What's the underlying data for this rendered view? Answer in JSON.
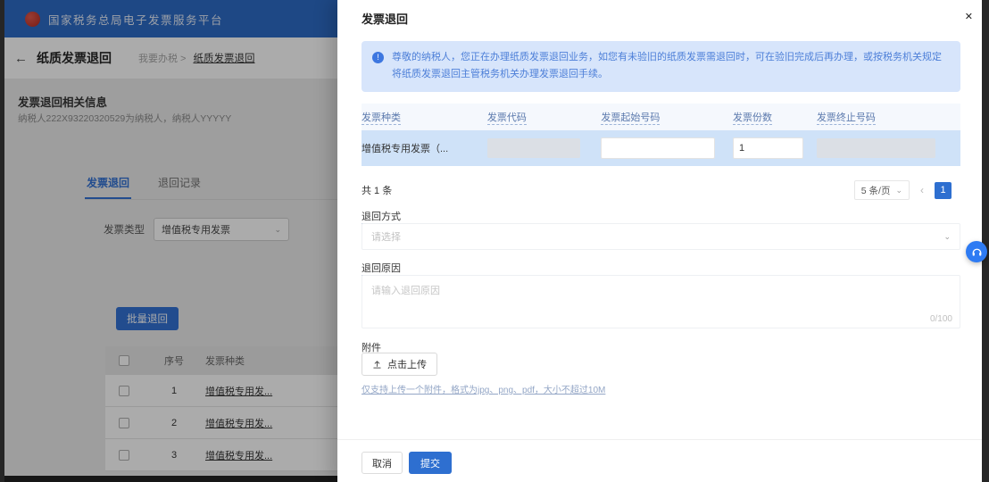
{
  "icons": {
    "back": "←",
    "close": "✕",
    "caret_down": "⌄",
    "page_prev": "‹",
    "alert_info": "!"
  },
  "header": {
    "title": "国家税务总局电子发票服务平台"
  },
  "left_page": {
    "page_title": "纸质发票退回",
    "breadcrumb_dim": "我要办税 >",
    "breadcrumb_current": "纸质发票退回",
    "info_title": "发票退回相关信息",
    "info_text": "纳税人222X93220320529为纳税人，纳税人YYYYY",
    "tabs": [
      {
        "label": "发票退回"
      },
      {
        "label": "退回记录"
      }
    ],
    "filter_label": "发票类型",
    "filter_value": "增值税专用发票",
    "batch_button": "批量退回",
    "table": {
      "col_seq": "序号",
      "col_type": "发票种类",
      "rows": [
        {
          "seq": "1",
          "type": "增值税专用发..."
        },
        {
          "seq": "2",
          "type": "增值税专用发..."
        },
        {
          "seq": "3",
          "type": "增值税专用发..."
        }
      ]
    }
  },
  "drawer": {
    "title": "发票退回",
    "alert_text": "尊敬的纳税人，您正在办理纸质发票退回业务，如您有未验旧的纸质发票需退回时，可在验旧完成后再办理，或按税务机关规定将纸质发票退回主管税务机关办理发票退回手续。",
    "table": {
      "headers": [
        "发票种类",
        "发票代码",
        "发票起始号码",
        "发票份数",
        "发票终止号码"
      ],
      "row": {
        "type": "增值税专用发票（...",
        "count": "1"
      }
    },
    "total_text": "共 1 条",
    "page_size": "5 条/页",
    "page_current": "1",
    "method_label": "退回方式",
    "method_placeholder": "请选择",
    "reason_label": "退回原因",
    "reason_placeholder": "请输入退回原因",
    "reason_counter": "0/100",
    "attachment_label": "附件",
    "upload_button": "点击上传",
    "upload_hint": "仅支持上传一个附件，格式为jpg、png、pdf，大小不超过10M",
    "cancel_button": "取消",
    "submit_button": "提交"
  },
  "colors": {
    "primary": "#2e6fd0",
    "header_blue": "#2a69c6",
    "alert_bg": "#d7e5fb",
    "alert_text": "#4d7fd8",
    "row_highlight": "#cfe2f8"
  }
}
